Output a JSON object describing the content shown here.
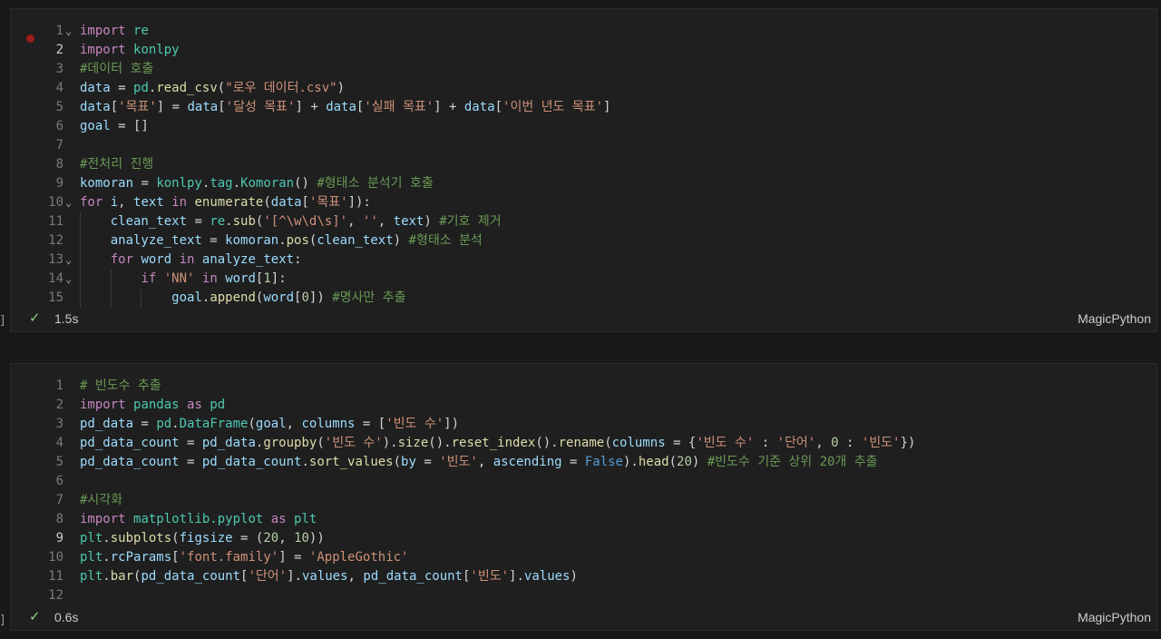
{
  "cells": [
    {
      "status": {
        "duration": "1.5s",
        "language": "MagicPython"
      },
      "lines": [
        {
          "n": "1",
          "fold": true,
          "tokens": [
            [
              "k",
              "import"
            ],
            [
              "p",
              " "
            ],
            [
              "c",
              "re"
            ]
          ]
        },
        {
          "n": "2",
          "active": true,
          "tokens": [
            [
              "k",
              "import"
            ],
            [
              "p",
              " "
            ],
            [
              "c",
              "konlpy"
            ]
          ]
        },
        {
          "n": "3",
          "tokens": [
            [
              "m",
              "#데이터 호출"
            ]
          ]
        },
        {
          "n": "4",
          "tokens": [
            [
              "v",
              "data"
            ],
            [
              "p",
              " = "
            ],
            [
              "c",
              "pd"
            ],
            [
              "p",
              "."
            ],
            [
              "f",
              "read_csv"
            ],
            [
              "p",
              "("
            ],
            [
              "s",
              "\"로우 데이터.csv\""
            ],
            [
              "p",
              ")"
            ]
          ]
        },
        {
          "n": "5",
          "tokens": [
            [
              "v",
              "data"
            ],
            [
              "p",
              "["
            ],
            [
              "s",
              "'목표'"
            ],
            [
              "p",
              "] = "
            ],
            [
              "v",
              "data"
            ],
            [
              "p",
              "["
            ],
            [
              "s",
              "'달성 목표'"
            ],
            [
              "p",
              "] + "
            ],
            [
              "v",
              "data"
            ],
            [
              "p",
              "["
            ],
            [
              "s",
              "'실패 목표'"
            ],
            [
              "p",
              "] + "
            ],
            [
              "v",
              "data"
            ],
            [
              "p",
              "["
            ],
            [
              "s",
              "'이번 년도 목표'"
            ],
            [
              "p",
              "]"
            ]
          ]
        },
        {
          "n": "6",
          "tokens": [
            [
              "v",
              "goal"
            ],
            [
              "p",
              " = []"
            ]
          ]
        },
        {
          "n": "7",
          "tokens": []
        },
        {
          "n": "8",
          "tokens": [
            [
              "m",
              "#전처리 진행"
            ]
          ]
        },
        {
          "n": "9",
          "tokens": [
            [
              "v",
              "komoran"
            ],
            [
              "p",
              " = "
            ],
            [
              "c",
              "konlpy"
            ],
            [
              "p",
              "."
            ],
            [
              "c",
              "tag"
            ],
            [
              "p",
              "."
            ],
            [
              "c",
              "Komoran"
            ],
            [
              "p",
              "() "
            ],
            [
              "m",
              "#형태소 분석기 호출"
            ]
          ]
        },
        {
          "n": "10",
          "fold": true,
          "tokens": [
            [
              "k",
              "for"
            ],
            [
              "p",
              " "
            ],
            [
              "v",
              "i"
            ],
            [
              "p",
              ", "
            ],
            [
              "v",
              "text"
            ],
            [
              "p",
              " "
            ],
            [
              "k",
              "in"
            ],
            [
              "p",
              " "
            ],
            [
              "f",
              "enumerate"
            ],
            [
              "p",
              "("
            ],
            [
              "v",
              "data"
            ],
            [
              "p",
              "["
            ],
            [
              "s",
              "'목표'"
            ],
            [
              "p",
              "]):"
            ]
          ]
        },
        {
          "n": "11",
          "indent": 1,
          "tokens": [
            [
              "p",
              "    "
            ],
            [
              "v",
              "clean_text"
            ],
            [
              "p",
              " = "
            ],
            [
              "c",
              "re"
            ],
            [
              "p",
              "."
            ],
            [
              "f",
              "sub"
            ],
            [
              "p",
              "("
            ],
            [
              "s",
              "'[^\\w\\d\\s]'"
            ],
            [
              "p",
              ", "
            ],
            [
              "s",
              "''"
            ],
            [
              "p",
              ", "
            ],
            [
              "v",
              "text"
            ],
            [
              "p",
              ") "
            ],
            [
              "m",
              "#기호 제거"
            ]
          ]
        },
        {
          "n": "12",
          "indent": 1,
          "tokens": [
            [
              "p",
              "    "
            ],
            [
              "v",
              "analyze_text"
            ],
            [
              "p",
              " = "
            ],
            [
              "v",
              "komoran"
            ],
            [
              "p",
              "."
            ],
            [
              "f",
              "pos"
            ],
            [
              "p",
              "("
            ],
            [
              "v",
              "clean_text"
            ],
            [
              "p",
              ") "
            ],
            [
              "m",
              "#형태소 분석"
            ]
          ]
        },
        {
          "n": "13",
          "indent": 1,
          "fold": true,
          "tokens": [
            [
              "p",
              "    "
            ],
            [
              "k",
              "for"
            ],
            [
              "p",
              " "
            ],
            [
              "v",
              "word"
            ],
            [
              "p",
              " "
            ],
            [
              "k",
              "in"
            ],
            [
              "p",
              " "
            ],
            [
              "v",
              "analyze_text"
            ],
            [
              "p",
              ":"
            ]
          ]
        },
        {
          "n": "14",
          "indent": 2,
          "fold": true,
          "tokens": [
            [
              "p",
              "        "
            ],
            [
              "k",
              "if"
            ],
            [
              "p",
              " "
            ],
            [
              "s",
              "'NN'"
            ],
            [
              "p",
              " "
            ],
            [
              "k",
              "in"
            ],
            [
              "p",
              " "
            ],
            [
              "v",
              "word"
            ],
            [
              "p",
              "["
            ],
            [
              "n",
              "1"
            ],
            [
              "p",
              "]:"
            ]
          ]
        },
        {
          "n": "15",
          "indent": 3,
          "tokens": [
            [
              "p",
              "            "
            ],
            [
              "v",
              "goal"
            ],
            [
              "p",
              "."
            ],
            [
              "f",
              "append"
            ],
            [
              "p",
              "("
            ],
            [
              "v",
              "word"
            ],
            [
              "p",
              "["
            ],
            [
              "n",
              "0"
            ],
            [
              "p",
              "]) "
            ],
            [
              "m",
              "#명사만 추출"
            ]
          ]
        }
      ]
    },
    {
      "status": {
        "duration": "0.6s",
        "language": "MagicPython"
      },
      "lines": [
        {
          "n": "1",
          "tokens": [
            [
              "m",
              "# 빈도수 추출"
            ]
          ]
        },
        {
          "n": "2",
          "tokens": [
            [
              "k",
              "import"
            ],
            [
              "p",
              " "
            ],
            [
              "c",
              "pandas"
            ],
            [
              "p",
              " "
            ],
            [
              "k",
              "as"
            ],
            [
              "p",
              " "
            ],
            [
              "c",
              "pd"
            ]
          ]
        },
        {
          "n": "3",
          "tokens": [
            [
              "v",
              "pd_data"
            ],
            [
              "p",
              " = "
            ],
            [
              "c",
              "pd"
            ],
            [
              "p",
              "."
            ],
            [
              "c",
              "DataFrame"
            ],
            [
              "p",
              "("
            ],
            [
              "v",
              "goal"
            ],
            [
              "p",
              ", "
            ],
            [
              "v",
              "columns"
            ],
            [
              "p",
              " = ["
            ],
            [
              "s",
              "'빈도 수'"
            ],
            [
              "p",
              "])"
            ]
          ]
        },
        {
          "n": "4",
          "tokens": [
            [
              "v",
              "pd_data_count"
            ],
            [
              "p",
              " = "
            ],
            [
              "v",
              "pd_data"
            ],
            [
              "p",
              "."
            ],
            [
              "f",
              "groupby"
            ],
            [
              "p",
              "("
            ],
            [
              "s",
              "'빈도 수'"
            ],
            [
              "p",
              ")."
            ],
            [
              "f",
              "size"
            ],
            [
              "p",
              "()."
            ],
            [
              "f",
              "reset_index"
            ],
            [
              "p",
              "()."
            ],
            [
              "f",
              "rename"
            ],
            [
              "p",
              "("
            ],
            [
              "v",
              "columns"
            ],
            [
              "p",
              " = {"
            ],
            [
              "s",
              "'빈도 수'"
            ],
            [
              "p",
              " : "
            ],
            [
              "s",
              "'단어'"
            ],
            [
              "p",
              ", "
            ],
            [
              "n",
              "0"
            ],
            [
              "p",
              " : "
            ],
            [
              "s",
              "'빈도'"
            ],
            [
              "p",
              "})"
            ]
          ]
        },
        {
          "n": "5",
          "tokens": [
            [
              "v",
              "pd_data_count"
            ],
            [
              "p",
              " = "
            ],
            [
              "v",
              "pd_data_count"
            ],
            [
              "p",
              "."
            ],
            [
              "f",
              "sort_values"
            ],
            [
              "p",
              "("
            ],
            [
              "v",
              "by"
            ],
            [
              "p",
              " = "
            ],
            [
              "s",
              "'빈도'"
            ],
            [
              "p",
              ", "
            ],
            [
              "v",
              "ascending"
            ],
            [
              "p",
              " = "
            ],
            [
              "b",
              "False"
            ],
            [
              "p",
              ")."
            ],
            [
              "f",
              "head"
            ],
            [
              "p",
              "("
            ],
            [
              "n",
              "20"
            ],
            [
              "p",
              ") "
            ],
            [
              "m",
              "#빈도수 기준 상위 20개 추출"
            ]
          ]
        },
        {
          "n": "6",
          "tokens": []
        },
        {
          "n": "7",
          "tokens": [
            [
              "m",
              "#시각화"
            ]
          ]
        },
        {
          "n": "8",
          "tokens": [
            [
              "k",
              "import"
            ],
            [
              "p",
              " "
            ],
            [
              "c",
              "matplotlib.pyplot"
            ],
            [
              "p",
              " "
            ],
            [
              "k",
              "as"
            ],
            [
              "p",
              " "
            ],
            [
              "c",
              "plt"
            ]
          ]
        },
        {
          "n": "9",
          "active": true,
          "tokens": [
            [
              "c",
              "plt"
            ],
            [
              "p",
              "."
            ],
            [
              "f",
              "subplots"
            ],
            [
              "p",
              "("
            ],
            [
              "v",
              "figsize"
            ],
            [
              "p",
              " = ("
            ],
            [
              "n",
              "20"
            ],
            [
              "p",
              ", "
            ],
            [
              "n",
              "10"
            ],
            [
              "p",
              "))"
            ]
          ]
        },
        {
          "n": "10",
          "tokens": [
            [
              "c",
              "plt"
            ],
            [
              "p",
              "."
            ],
            [
              "v",
              "rcParams"
            ],
            [
              "p",
              "["
            ],
            [
              "s",
              "'font.family'"
            ],
            [
              "p",
              "] = "
            ],
            [
              "s",
              "'AppleGothic'"
            ]
          ]
        },
        {
          "n": "11",
          "tokens": [
            [
              "c",
              "plt"
            ],
            [
              "p",
              "."
            ],
            [
              "f",
              "bar"
            ],
            [
              "p",
              "("
            ],
            [
              "v",
              "pd_data_count"
            ],
            [
              "p",
              "["
            ],
            [
              "s",
              "'단어'"
            ],
            [
              "p",
              "]."
            ],
            [
              "v",
              "values"
            ],
            [
              "p",
              ", "
            ],
            [
              "v",
              "pd_data_count"
            ],
            [
              "p",
              "["
            ],
            [
              "s",
              "'빈도'"
            ],
            [
              "p",
              "]."
            ],
            [
              "v",
              "values"
            ],
            [
              "p",
              ")"
            ]
          ]
        },
        {
          "n": "12",
          "tokens": []
        }
      ]
    }
  ],
  "edge_marker": "]",
  "icons": {
    "check": "check-icon",
    "fold": "chevron-down-icon",
    "breakpoint": "breakpoint-dot-icon"
  },
  "colors": {
    "keyword": "#c586c0",
    "string": "#ce9178",
    "comment": "#6a9955",
    "function": "#dcdcaa",
    "success": "#89d185"
  }
}
